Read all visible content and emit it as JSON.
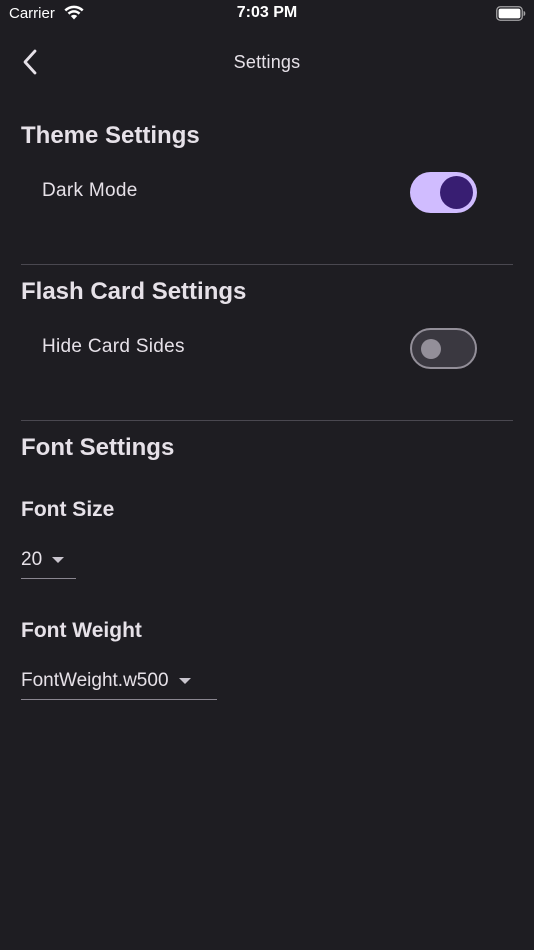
{
  "status_bar": {
    "carrier": "Carrier",
    "time": "7:03 PM"
  },
  "app_bar": {
    "title": "Settings"
  },
  "theme": {
    "title": "Theme Settings",
    "dark_mode_label": "Dark Mode",
    "dark_mode_on": true
  },
  "flash": {
    "title": "Flash Card Settings",
    "hide_sides_label": "Hide Card Sides",
    "hide_sides_on": false
  },
  "font": {
    "title": "Font Settings",
    "size_label": "Font Size",
    "size_value": "20",
    "weight_label": "Font Weight",
    "weight_value": "FontWeight.w500"
  },
  "colors": {
    "background": "#1e1d22",
    "switch_on_track": "#d0bcff",
    "switch_on_knob": "#381e72",
    "switch_off_outline": "#938f99"
  }
}
